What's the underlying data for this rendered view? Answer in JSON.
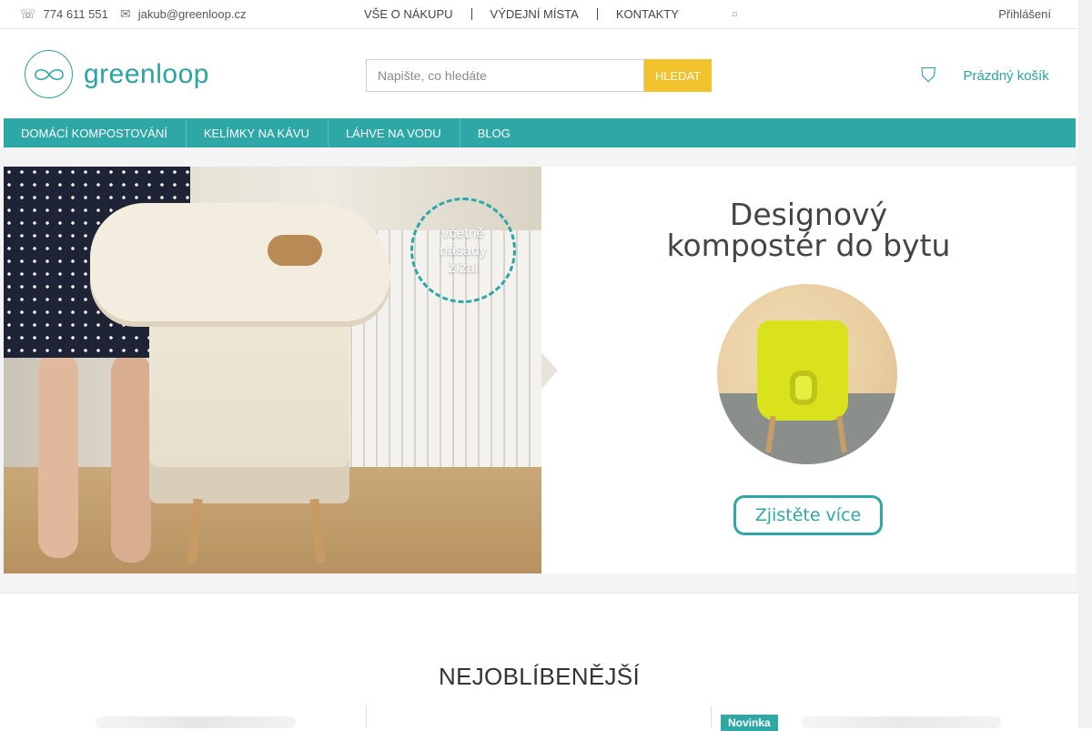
{
  "topbar": {
    "phone": "774 611 551",
    "email": "jakub@greenloop.cz",
    "links": [
      "VŠE O NÁKUPU",
      "VÝDEJNÍ MÍSTA",
      "KONTAKTY"
    ],
    "login": "Přihlášení"
  },
  "header": {
    "logo_text": "greenloop",
    "search_placeholder": "Napište, co hledáte",
    "search_button": "HLEDAT",
    "cart_label": "Prázdný košík"
  },
  "nav": {
    "items": [
      "DOMÁCÍ KOMPOSTOVÁNÍ",
      "KELÍMKY NA KÁVU",
      "LÁHVE NA VODU",
      "BLOG"
    ]
  },
  "banner": {
    "badge_lines": [
      "včetně",
      "násady",
      "žížal"
    ],
    "title_line1": "Designový",
    "title_line2": "kompostér do bytu",
    "cta": "Zjistěte více"
  },
  "section": {
    "title": "NEJOBLÍBENĚJŠÍ",
    "badge_new": "Novinka"
  },
  "colors": {
    "brand": "#2ea7a7",
    "search_button": "#f2c22c"
  }
}
